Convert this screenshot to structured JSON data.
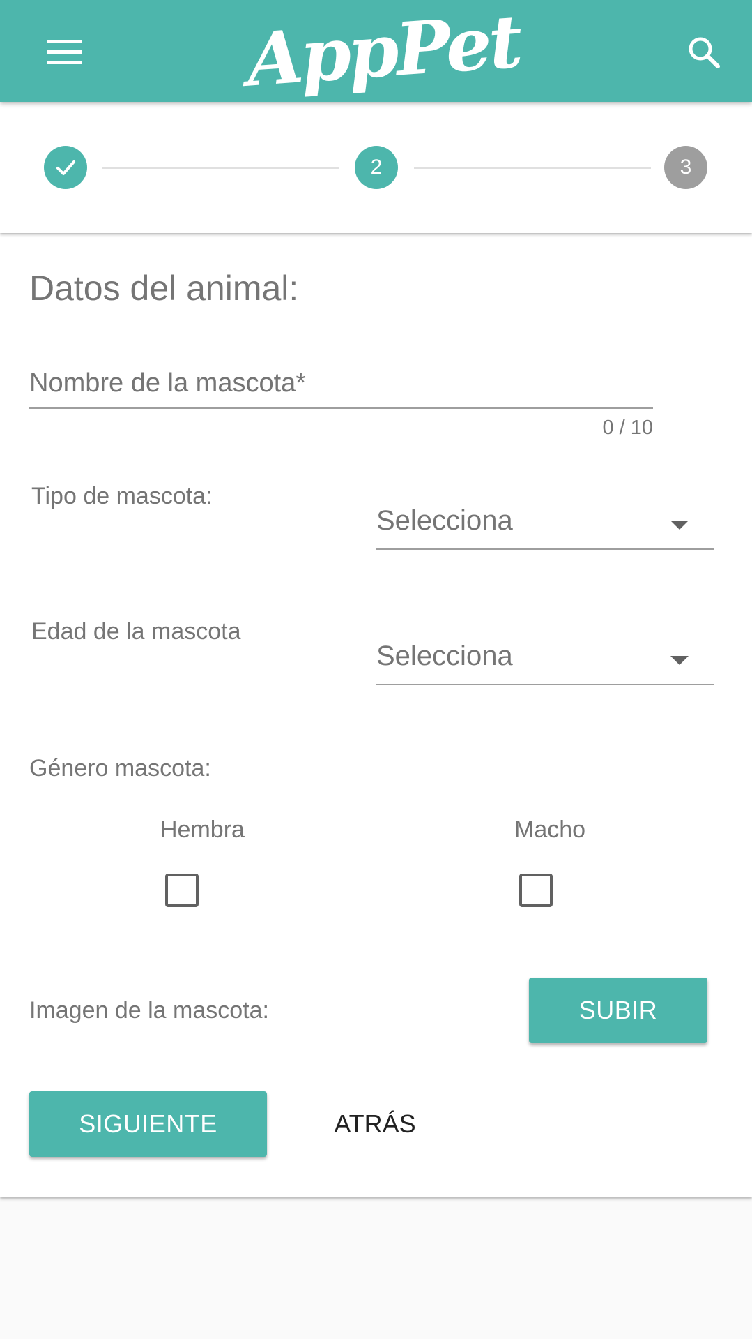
{
  "toolbar": {
    "logo_text": "AppPet",
    "menu_icon": "menu-icon",
    "search_icon": "search-icon",
    "background": "#4db6ac"
  },
  "stepper": {
    "steps": [
      {
        "label": "1",
        "state": "done",
        "icon": "check-icon"
      },
      {
        "label": "2",
        "state": "active"
      },
      {
        "label": "3",
        "state": "pending"
      }
    ],
    "active_color": "#4db6ac",
    "pending_color": "#9e9e9e"
  },
  "form": {
    "title": "Datos del animal:",
    "name_field": {
      "placeholder": "Nombre de la mascota*",
      "value": "",
      "counter": "0 / 10"
    },
    "type_field": {
      "label": "Tipo de mascota:",
      "selected": "Selecciona"
    },
    "age_field": {
      "label": "Edad de la mascota",
      "selected": "Selecciona"
    },
    "gender": {
      "label": "Género mascota:",
      "options": [
        {
          "label": "Hembra",
          "checked": false
        },
        {
          "label": "Macho",
          "checked": false
        }
      ]
    },
    "image": {
      "label": "Imagen de la mascota:",
      "upload_button": "SUBIR"
    },
    "actions": {
      "next_button": "SIGUIENTE",
      "back_button": "ATRÁS"
    }
  }
}
